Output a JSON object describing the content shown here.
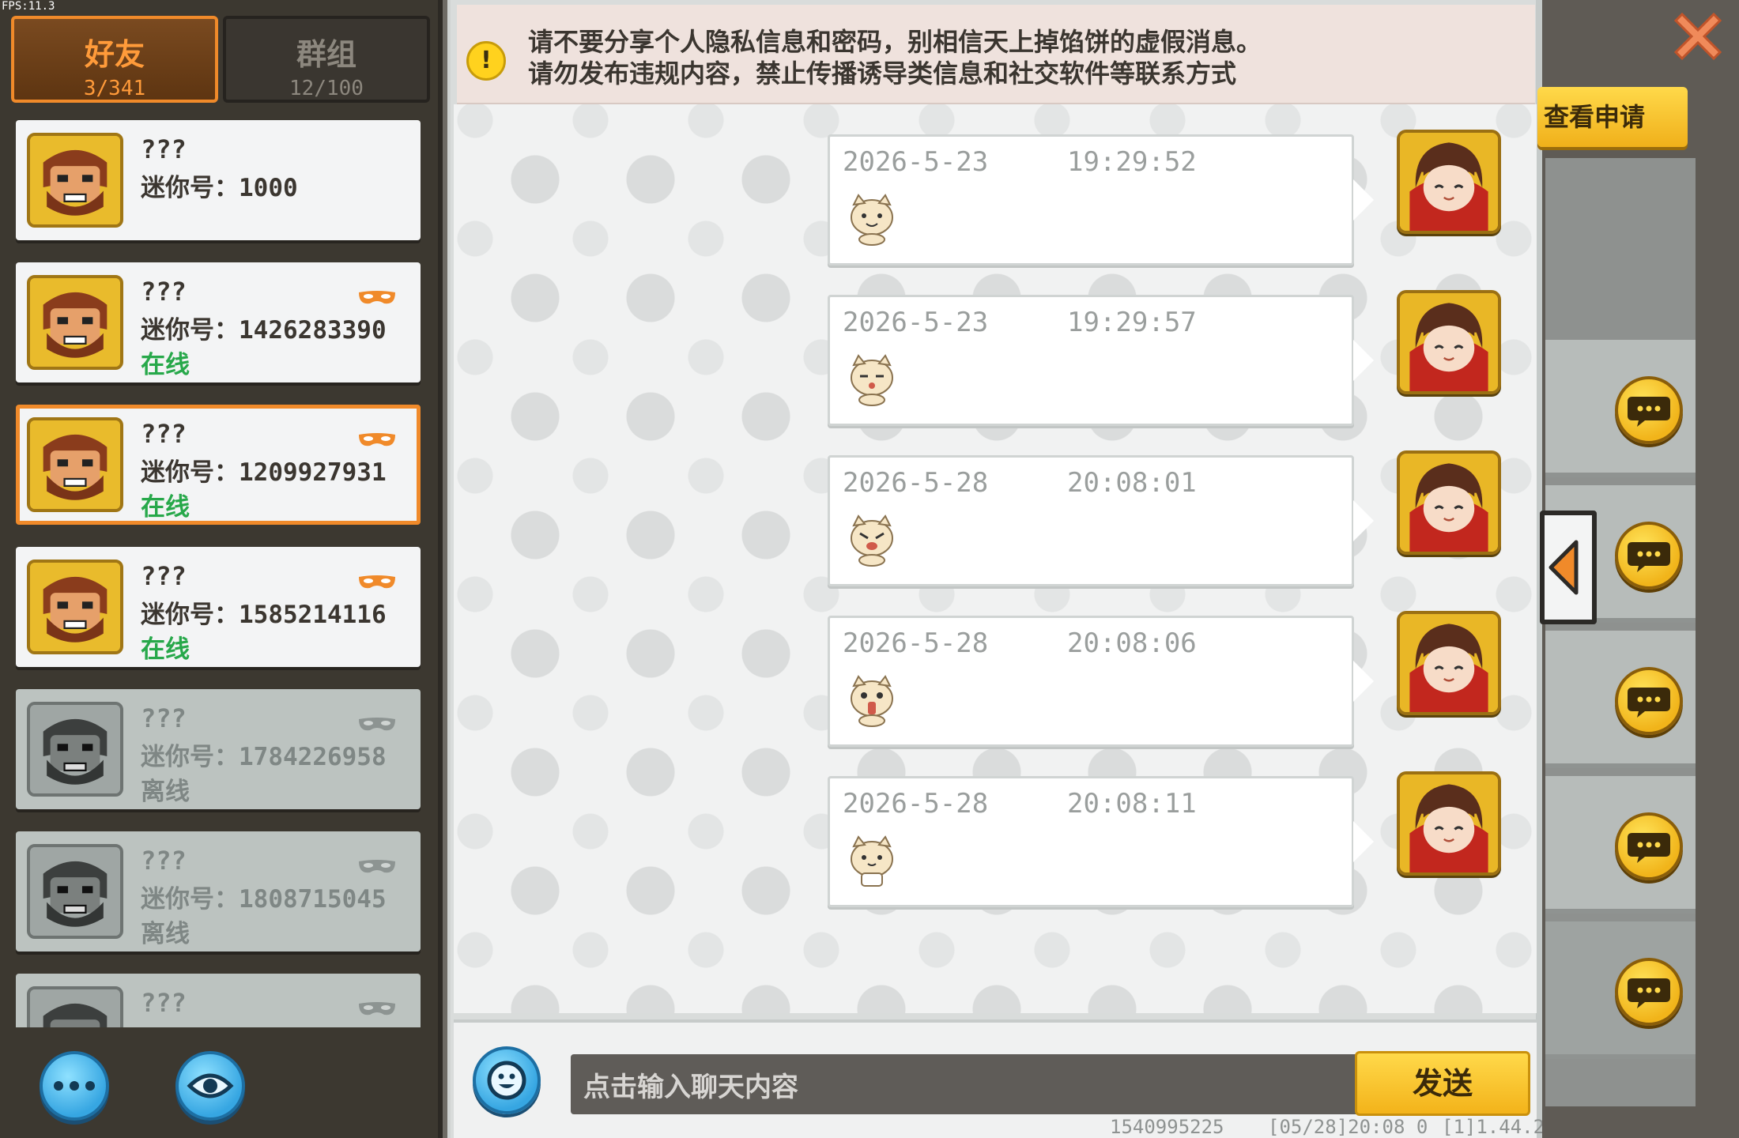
{
  "fps": "FPS:11.3",
  "tabs": [
    {
      "label": "好友",
      "count": "3/341"
    },
    {
      "label": "群组",
      "count": "12/100"
    }
  ],
  "friends": [
    {
      "name": "???",
      "id_label": "迷你号：",
      "id": "1000",
      "status": ""
    },
    {
      "name": "???",
      "id_label": "迷你号：",
      "id": "1426283390",
      "status": "在线"
    },
    {
      "name": "???",
      "id_label": "迷你号：",
      "id": "1209927931",
      "status": "在线"
    },
    {
      "name": "???",
      "id_label": "迷你号：",
      "id": "1585214116",
      "status": "在线"
    },
    {
      "name": "???",
      "id_label": "迷你号：",
      "id": "1784226958",
      "status": "离线"
    },
    {
      "name": "???",
      "id_label": "迷你号：",
      "id": "1808715045",
      "status": "离线"
    },
    {
      "name": "???",
      "id_label": "",
      "id": "",
      "status": ""
    }
  ],
  "notice": {
    "icon": "!",
    "line1": "请不要分享个人隐私信息和密码，别相信天上掉馅饼的虚假消息。",
    "line2": "请勿发布违规内容，禁止传播诱导类信息和社交软件等联系方式"
  },
  "messages": [
    {
      "date": "2026-5-23",
      "time": "19:29:52"
    },
    {
      "date": "2026-5-23",
      "time": "19:29:57"
    },
    {
      "date": "2026-5-28",
      "time": "20:08:01"
    },
    {
      "date": "2026-5-28",
      "time": "20:08:06"
    },
    {
      "date": "2026-5-28",
      "time": "20:08:11"
    }
  ],
  "input": {
    "placeholder": "点击输入聊天内容",
    "send_label": "发送"
  },
  "footer": {
    "uid": "1540995225",
    "timestamp": "[05/28]20:08 0",
    "version": "[1]1.44.2"
  },
  "right": {
    "view_requests_label": "查看申请"
  },
  "colors": {
    "accent_orange": "#f08a2a",
    "online_green": "#27a84a",
    "gold": "#f3b31a",
    "blue_button": "#36a6e2"
  },
  "icons": [
    "more-icon",
    "eye-icon",
    "emoji-icon",
    "warning-icon",
    "close-icon",
    "chat-bubble-icon",
    "collapse-arrow-icon",
    "mask-icon"
  ]
}
